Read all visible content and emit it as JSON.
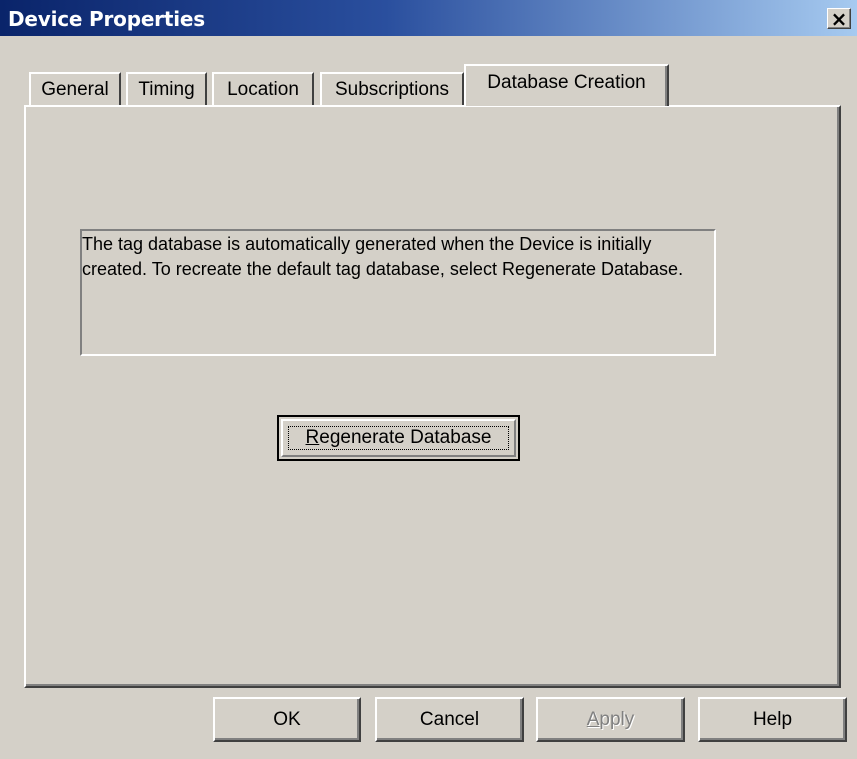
{
  "window": {
    "title": "Device Properties",
    "close_glyph": "×"
  },
  "tabs": [
    {
      "label": "General",
      "active": false
    },
    {
      "label": "Timing",
      "active": false
    },
    {
      "label": "Location",
      "active": false
    },
    {
      "label": "Subscriptions",
      "active": false
    },
    {
      "label": "Database Creation",
      "active": true
    }
  ],
  "database_creation": {
    "info_text": "The tag database is automatically generated when the Device is initially created.  To recreate the default tag database, select Regenerate Database.",
    "regenerate_button": {
      "mnemonic": "R",
      "label_rest": "egenerate Database"
    }
  },
  "buttons": {
    "ok": "OK",
    "cancel": "Cancel",
    "apply_mnemonic": "A",
    "apply_rest": "pply",
    "apply_enabled": false,
    "help": "Help"
  },
  "colors": {
    "titlebar_start": "#0a246a",
    "titlebar_end": "#a6caf0",
    "face": "#d4d0c8",
    "disabled_text": "#808080"
  }
}
